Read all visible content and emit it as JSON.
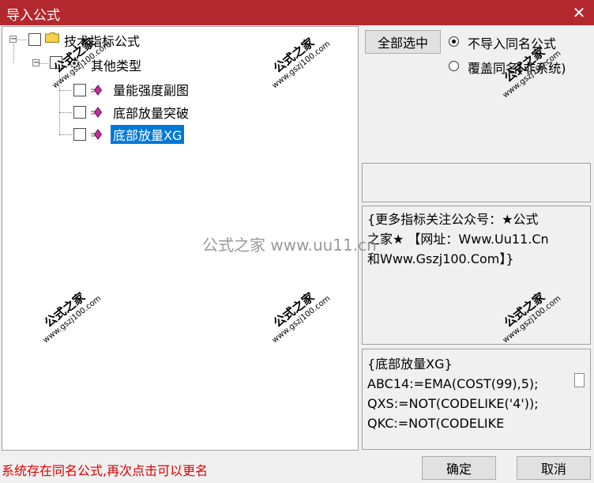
{
  "window": {
    "title": "导入公式",
    "close_glyph": "✕"
  },
  "tree": {
    "root": {
      "label": "技术指标公式",
      "expander": "−"
    },
    "group": {
      "label": "其他类型",
      "expander": "−"
    },
    "items": [
      {
        "label": "量能强度副图",
        "selected": false
      },
      {
        "label": "底部放量突破",
        "selected": false
      },
      {
        "label": "底部放量XG",
        "selected": true
      }
    ]
  },
  "actions": {
    "select_all_label": "全部选中",
    "radio_options": [
      {
        "label": "不导入同名公式",
        "checked": true
      },
      {
        "label": "覆盖同名(非系统)",
        "checked": false
      }
    ]
  },
  "info_box": {
    "lines": [
      "{更多指标关注公众号：★公式",
      "之家★ 【网址：Www.Uu11.Cn",
      "和Www.Gszj100.Com】}"
    ]
  },
  "code_box": {
    "lines": [
      "{底部放量XG}",
      "ABC14:=EMA(COST(99),5);",
      "QXS:=NOT(CODELIKE('4'));",
      "QKC:=NOT(CODELIKE"
    ]
  },
  "status": "系统存在同名公式,再次点击可以更名",
  "footer": {
    "ok_label": "确定",
    "cancel_label": "取消"
  },
  "watermarks": {
    "line1": "公式之家",
    "line2": "www.gszj100.com",
    "center": "公式之家 www.uu11.cn"
  },
  "colors": {
    "titlebar": "#b3282e",
    "selection": "#0078d7",
    "status": "#e00000"
  }
}
